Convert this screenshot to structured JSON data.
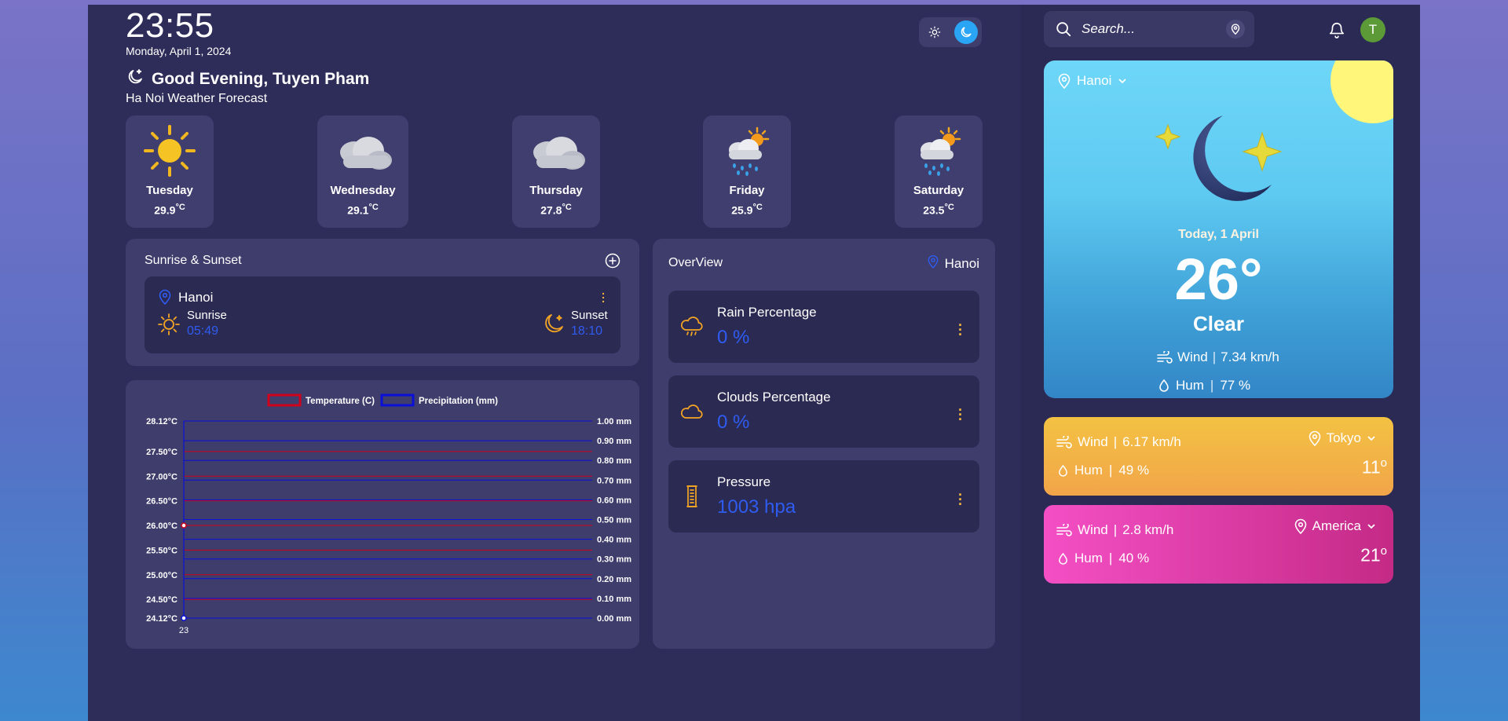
{
  "header": {
    "time": "23:55",
    "date": "Monday, April 1, 2024",
    "greeting": "Good Evening, Tuyen Pham",
    "forecast_title": "Ha Noi Weather Forecast"
  },
  "forecast": [
    {
      "day": "Tuesday",
      "temp": "29.9",
      "unit": "°C",
      "icon": "sun-icon"
    },
    {
      "day": "Wednesday",
      "temp": "29.1",
      "unit": "°C",
      "icon": "cloud-icon"
    },
    {
      "day": "Thursday",
      "temp": "27.8",
      "unit": "°C",
      "icon": "cloud-icon"
    },
    {
      "day": "Friday",
      "temp": "25.9",
      "unit": "°C",
      "icon": "rain-sun-icon"
    },
    {
      "day": "Saturday",
      "temp": "23.5",
      "unit": "°C",
      "icon": "rain-sun-icon"
    }
  ],
  "sunrise_sunset": {
    "title": "Sunrise & Sunset",
    "city": "Hanoi",
    "sunrise_label": "Sunrise",
    "sunrise_time": "05:49",
    "sunset_label": "Sunset",
    "sunset_time": "18:10"
  },
  "chart_data": {
    "type": "line",
    "series": [
      {
        "name": "Temperature (C)",
        "color": "#d0021b",
        "x": [
          "23"
        ],
        "values": [
          26.0
        ]
      },
      {
        "name": "Precipitation (mm)",
        "color": "#0a10d8",
        "x": [
          "23"
        ],
        "values": [
          0.0
        ]
      }
    ],
    "x": [
      "23"
    ],
    "y_left_ticks": [
      "28.12°C",
      "27.50°C",
      "27.00°C",
      "26.50°C",
      "26.00°C",
      "25.50°C",
      "25.00°C",
      "24.50°C",
      "24.12°C"
    ],
    "y_right_ticks": [
      "1.00 mm",
      "0.90 mm",
      "0.80 mm",
      "0.70 mm",
      "0.60 mm",
      "0.50 mm",
      "0.40 mm",
      "0.30 mm",
      "0.20 mm",
      "0.10 mm",
      "0.00 mm"
    ],
    "ylim_left": [
      24.12,
      28.12
    ],
    "ylim_right": [
      0,
      1
    ],
    "legend_position": "top"
  },
  "overview": {
    "title": "OverView",
    "city": "Hanoi",
    "cards": [
      {
        "label": "Rain Percentage",
        "value": "0 %"
      },
      {
        "label": "Clouds Percentage",
        "value": "0 %"
      },
      {
        "label": "Pressure",
        "value": "1003 hpa"
      }
    ]
  },
  "sidebar": {
    "search_placeholder": "Search...",
    "avatar_initial": "T",
    "hero": {
      "city": "Hanoi",
      "date": "Today, 1 April",
      "temp": "26°",
      "condition": "Clear",
      "wind_label": "Wind",
      "wind_value": "7.34 km/h",
      "hum_label": "Hum",
      "hum_value": "77 %"
    },
    "cities": [
      {
        "city": "Tokyo",
        "wind_label": "Wind",
        "wind_value": "6.17 km/h",
        "hum_label": "Hum",
        "hum_value": "49 %",
        "temp": "11",
        "deg": "o"
      },
      {
        "city": "America",
        "wind_label": "Wind",
        "wind_value": "2.8 km/h",
        "hum_label": "Hum",
        "hum_value": "40 %",
        "temp": "21",
        "deg": "o"
      }
    ]
  },
  "colors": {
    "accent_blue": "#2f5cf0",
    "accent_orange": "#f5a623",
    "panel": "#3e3d6c",
    "toggle_active": "#2aa4f4"
  }
}
